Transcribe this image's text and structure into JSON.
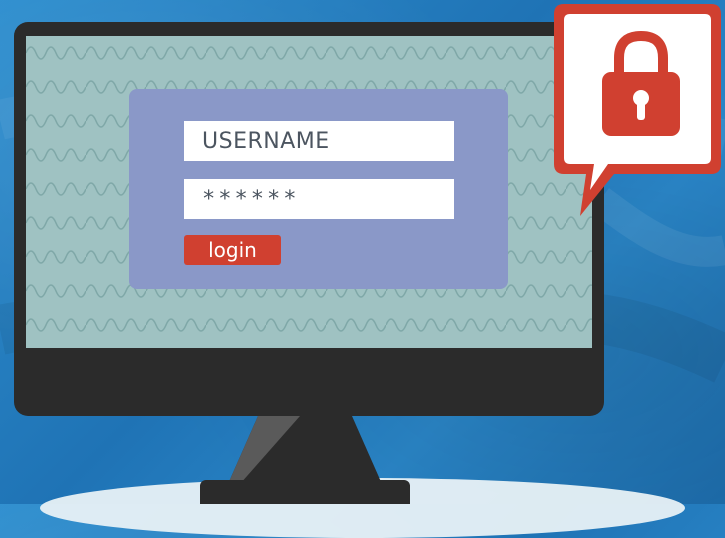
{
  "login_form": {
    "username_placeholder": "USERNAME",
    "password_value": "******",
    "login_label": "login"
  },
  "icons": {
    "lock": "lock-icon"
  },
  "colors": {
    "background": "#2a86c8",
    "monitor": "#2b2b2b",
    "screen": "#9fc2c2",
    "panel": "#8a98c8",
    "accent_red": "#d04030"
  }
}
